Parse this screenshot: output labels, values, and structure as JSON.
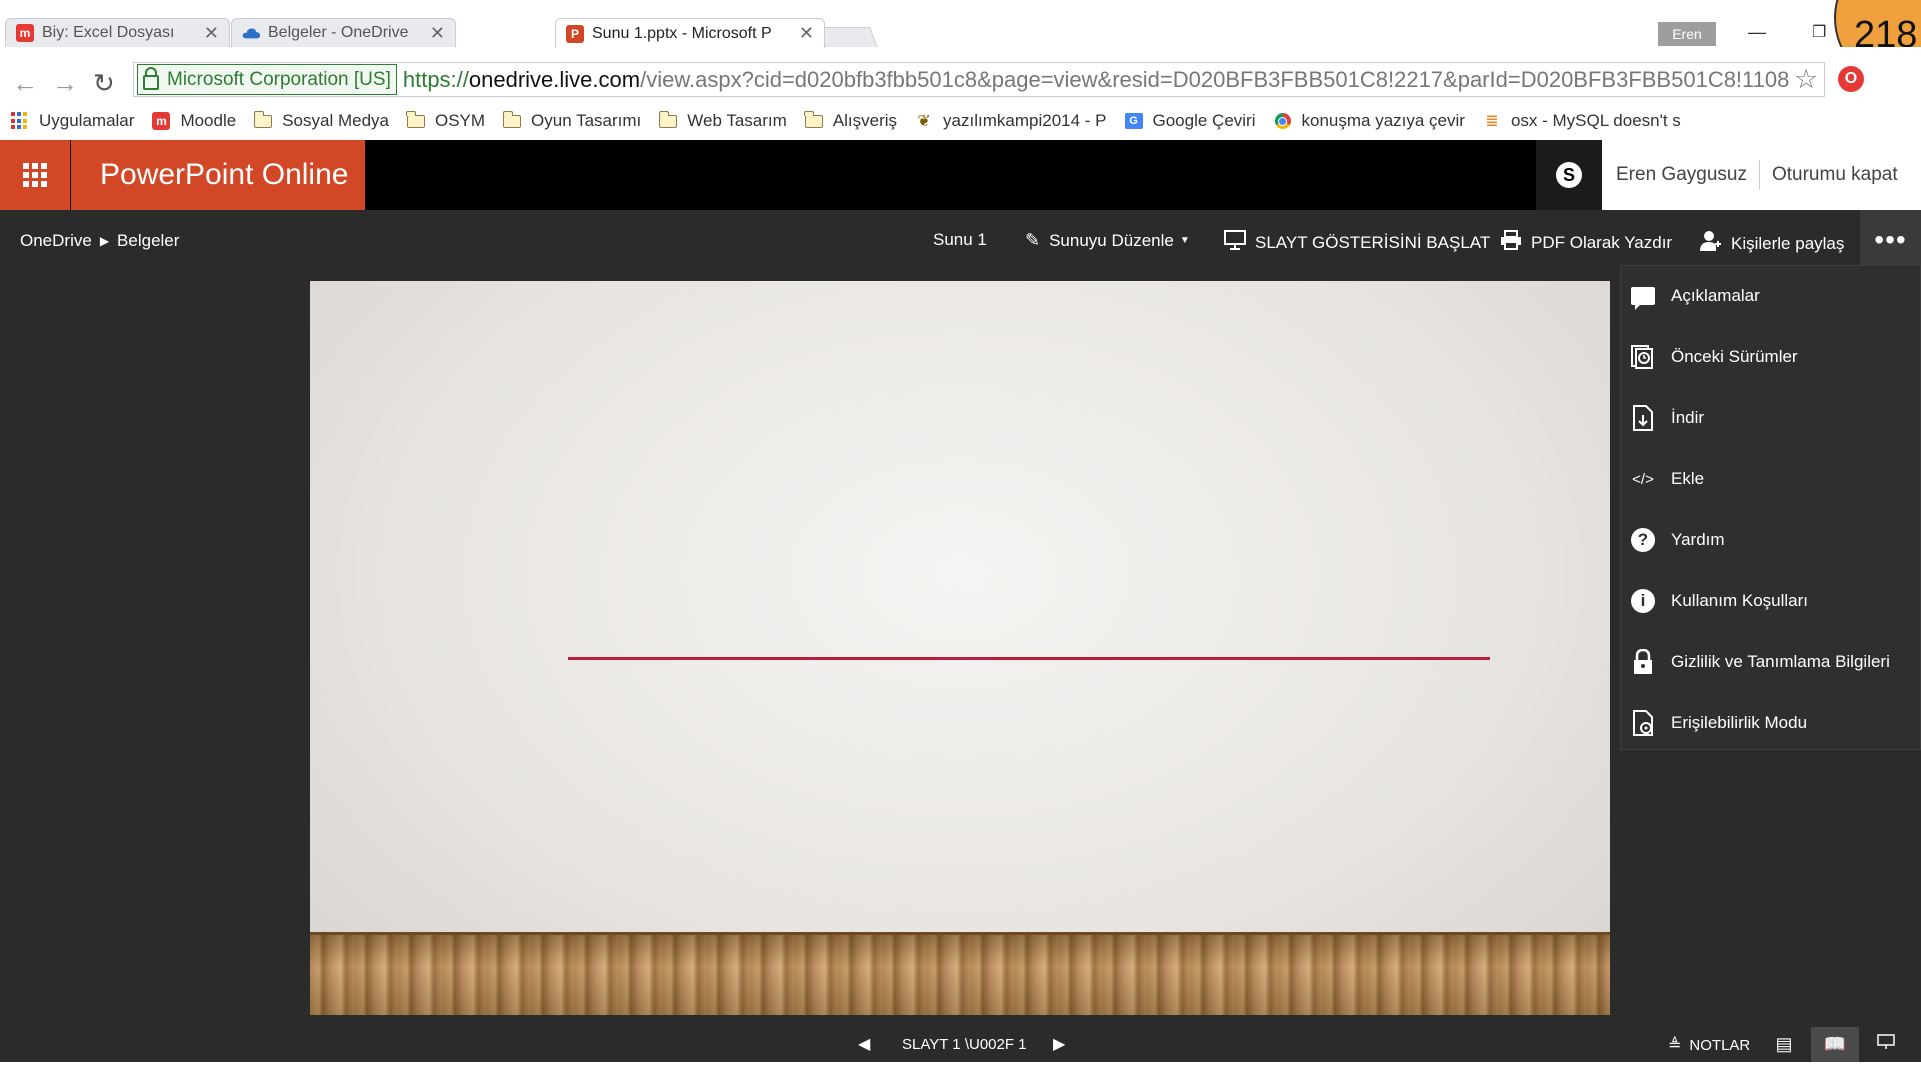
{
  "browser": {
    "tabs": [
      {
        "title": "Biy: Excel Dosyası",
        "icon": "moodle-icon",
        "active": false
      },
      {
        "title": "Belgeler - OneDrive",
        "icon": "onedrive-cloud-icon",
        "active": false
      },
      {
        "title": "Sunu 1.pptx - Microsoft P",
        "icon": "powerpoint-icon",
        "active": true
      }
    ],
    "tab_close": "✕",
    "profile_name": "Eren",
    "address": {
      "security_label": "Microsoft Corporation [US]",
      "url_scheme": "https://",
      "url_host": "onedrive.live.com",
      "url_rest": "/view.aspx?cid=d020bfb3fbb501c8&page=view&resid=D020BFB3FBB501C8!2217&parId=D020BFB3FBB501C8!1108"
    },
    "bookmarks": [
      {
        "label": "Uygulamalar",
        "icon": "apps-grid-icon"
      },
      {
        "label": "Moodle",
        "icon": "moodle-icon"
      },
      {
        "label": "Sosyal Medya",
        "icon": "folder-icon"
      },
      {
        "label": "OSYM",
        "icon": "folder-icon"
      },
      {
        "label": "Oyun Tasarımı",
        "icon": "folder-icon"
      },
      {
        "label": "Web Tasarım",
        "icon": "folder-icon"
      },
      {
        "label": "Alışveriş",
        "icon": "folder-icon"
      },
      {
        "label": "yazılımkampi2014 - P",
        "icon": "site-icon"
      },
      {
        "label": "Google Çeviri",
        "icon": "google-translate-icon"
      },
      {
        "label": "konuşma yazıya çevir",
        "icon": "chrome-icon"
      },
      {
        "label": "osx - MySQL doesn't s",
        "icon": "stackoverflow-icon"
      }
    ]
  },
  "badge_number": "218",
  "app": {
    "name": "PowerPoint Online",
    "user_name": "Eren Gaygusuz",
    "sign_out": "Oturumu kapat",
    "breadcrumb": [
      "OneDrive",
      "Belgeler"
    ],
    "doc_title": "Sunu 1",
    "commands": {
      "edit": "Sunuyu Düzenle",
      "slideshow": "SLAYT GÖSTERİSİNİ BAŞLAT",
      "pdf": "PDF Olarak Yazdır",
      "share": "Kişilerle paylaş"
    },
    "more_menu": [
      {
        "label": "Açıklamalar",
        "icon": "comment-icon"
      },
      {
        "label": "Önceki Sürümler",
        "icon": "previous-versions-icon"
      },
      {
        "label": "İndir",
        "icon": "download-icon"
      },
      {
        "label": "Ekle",
        "icon": "embed-code-icon"
      },
      {
        "label": "Yardım",
        "icon": "help-icon"
      },
      {
        "label": "Kullanım Koşulları",
        "icon": "info-icon"
      },
      {
        "label": "Gizlilik ve Tanımlama Bilgileri",
        "icon": "lock-icon"
      },
      {
        "label": "Erişilebilirlik Modu",
        "icon": "accessibility-icon"
      }
    ],
    "status": {
      "slide_indicator": "SLAYT 1 \\U002F 1",
      "notes": "NOTLAR"
    },
    "colors": {
      "brand": "#d24726",
      "slide_line": "#b91f3c"
    }
  }
}
